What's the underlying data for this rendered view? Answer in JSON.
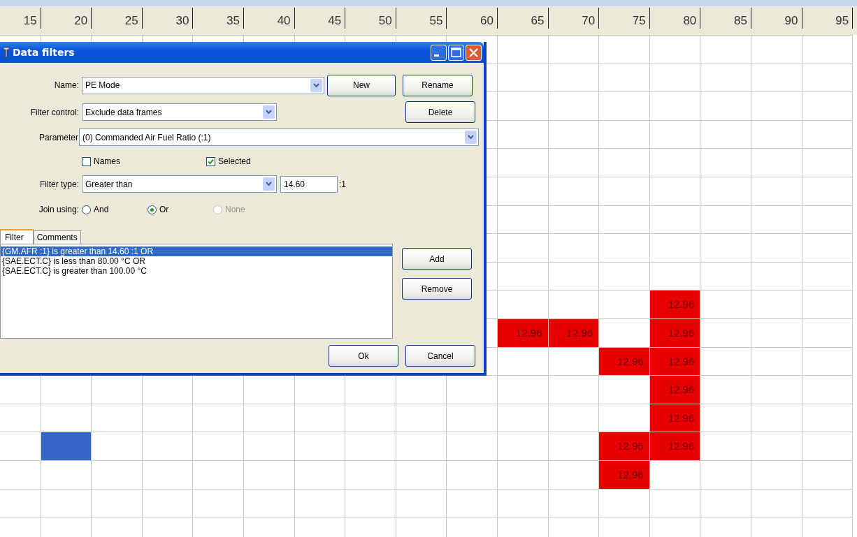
{
  "grid": {
    "columns": [
      "15",
      "20",
      "25",
      "30",
      "35",
      "40",
      "45",
      "50",
      "55",
      "60",
      "65",
      "70",
      "75",
      "80",
      "85",
      "90",
      "95"
    ],
    "rows": [
      [
        null,
        null,
        null,
        null,
        null,
        null,
        null,
        null,
        null,
        null,
        null,
        null,
        null,
        null,
        null,
        null,
        null
      ],
      [
        null,
        null,
        null,
        null,
        null,
        null,
        null,
        null,
        null,
        null,
        null,
        null,
        null,
        null,
        null,
        null,
        null
      ],
      [
        null,
        null,
        null,
        null,
        null,
        null,
        null,
        null,
        null,
        null,
        null,
        null,
        null,
        null,
        null,
        null,
        null
      ],
      [
        null,
        null,
        null,
        null,
        null,
        null,
        null,
        null,
        null,
        null,
        null,
        null,
        null,
        null,
        null,
        null,
        null
      ],
      [
        null,
        null,
        null,
        null,
        null,
        null,
        null,
        null,
        null,
        null,
        null,
        null,
        null,
        null,
        null,
        null,
        null
      ],
      [
        null,
        null,
        null,
        null,
        null,
        null,
        null,
        null,
        null,
        null,
        null,
        null,
        null,
        null,
        null,
        null,
        null
      ],
      [
        null,
        null,
        null,
        null,
        null,
        null,
        null,
        null,
        null,
        null,
        null,
        null,
        null,
        null,
        null,
        null,
        null
      ],
      [
        null,
        null,
        null,
        null,
        null,
        null,
        null,
        null,
        null,
        null,
        null,
        null,
        null,
        null,
        null,
        null,
        null
      ],
      [
        null,
        null,
        null,
        null,
        null,
        null,
        null,
        null,
        null,
        null,
        null,
        null,
        null,
        null,
        null,
        null,
        null
      ],
      [
        null,
        null,
        null,
        null,
        null,
        null,
        null,
        null,
        null,
        null,
        null,
        null,
        null,
        {
          "kind": "value",
          "text": "12.96"
        },
        null,
        null,
        null
      ],
      [
        null,
        null,
        null,
        null,
        null,
        null,
        null,
        null,
        null,
        null,
        {
          "kind": "value",
          "text": "12.96"
        },
        {
          "kind": "value",
          "text": "12.96"
        },
        null,
        {
          "kind": "value",
          "text": "12.96"
        },
        null,
        null,
        null
      ],
      [
        null,
        null,
        null,
        null,
        null,
        null,
        null,
        null,
        null,
        null,
        null,
        null,
        {
          "kind": "value",
          "text": "12.96"
        },
        {
          "kind": "value",
          "text": "12.96"
        },
        null,
        null,
        null
      ],
      [
        null,
        null,
        null,
        null,
        null,
        null,
        null,
        null,
        null,
        null,
        null,
        null,
        null,
        {
          "kind": "value",
          "text": "12.96"
        },
        null,
        null,
        null
      ],
      [
        null,
        null,
        null,
        null,
        null,
        null,
        null,
        null,
        null,
        null,
        null,
        null,
        null,
        {
          "kind": "value",
          "text": "12.96"
        },
        null,
        null,
        null
      ],
      [
        null,
        {
          "kind": "selected"
        },
        null,
        null,
        null,
        null,
        null,
        null,
        null,
        null,
        null,
        null,
        {
          "kind": "value",
          "text": "12.96"
        },
        {
          "kind": "value",
          "text": "12.96"
        },
        null,
        null,
        null
      ],
      [
        null,
        null,
        null,
        null,
        null,
        null,
        null,
        null,
        null,
        null,
        null,
        null,
        {
          "kind": "value",
          "text": "12.96"
        },
        null,
        null,
        null,
        null
      ],
      [
        null,
        null,
        null,
        null,
        null,
        null,
        null,
        null,
        null,
        null,
        null,
        null,
        null,
        null,
        null,
        null,
        null
      ],
      [
        null,
        null,
        null,
        null,
        null,
        null,
        null,
        null,
        null,
        null,
        null,
        null,
        null,
        null,
        null,
        null,
        null
      ]
    ]
  },
  "dialog": {
    "title": "Data filters",
    "name": {
      "label": "Name:",
      "value": "PE Mode"
    },
    "new_button": "New",
    "rename_button": "Rename",
    "filter_control": {
      "label": "Filter control:",
      "value": "Exclude data frames"
    },
    "delete_button": "Delete",
    "parameter": {
      "label": "Parameter",
      "value": "(0) Commanded Air Fuel Ratio (:1)"
    },
    "checkboxes": [
      {
        "label": "Names",
        "checked": false
      },
      {
        "label": "Selected",
        "checked": true
      }
    ],
    "filter_type": {
      "label": "Filter type:",
      "value": "Greater than",
      "threshold": "14.60",
      "unit": ":1"
    },
    "join": {
      "label": "Join using:",
      "options": [
        {
          "label": "And",
          "selected": false,
          "disabled": false
        },
        {
          "label": "Or",
          "selected": true,
          "disabled": false
        },
        {
          "label": "None",
          "selected": false,
          "disabled": true
        }
      ]
    },
    "tabs": [
      {
        "label": "Filter",
        "selected": true
      },
      {
        "label": "Comments",
        "selected": false
      }
    ],
    "filters": [
      {
        "text": "{GM.AFR :1} is greater than 14.60 :1 OR",
        "selected": true
      },
      {
        "text": "{SAE.ECT.C} is less than 80.00 °C OR",
        "selected": false
      },
      {
        "text": "{SAE.ECT.C} is greater than 100.00 °C",
        "selected": false
      }
    ],
    "add_button": "Add",
    "remove_button": "Remove",
    "ok_button": "Ok",
    "cancel_button": "Cancel"
  }
}
